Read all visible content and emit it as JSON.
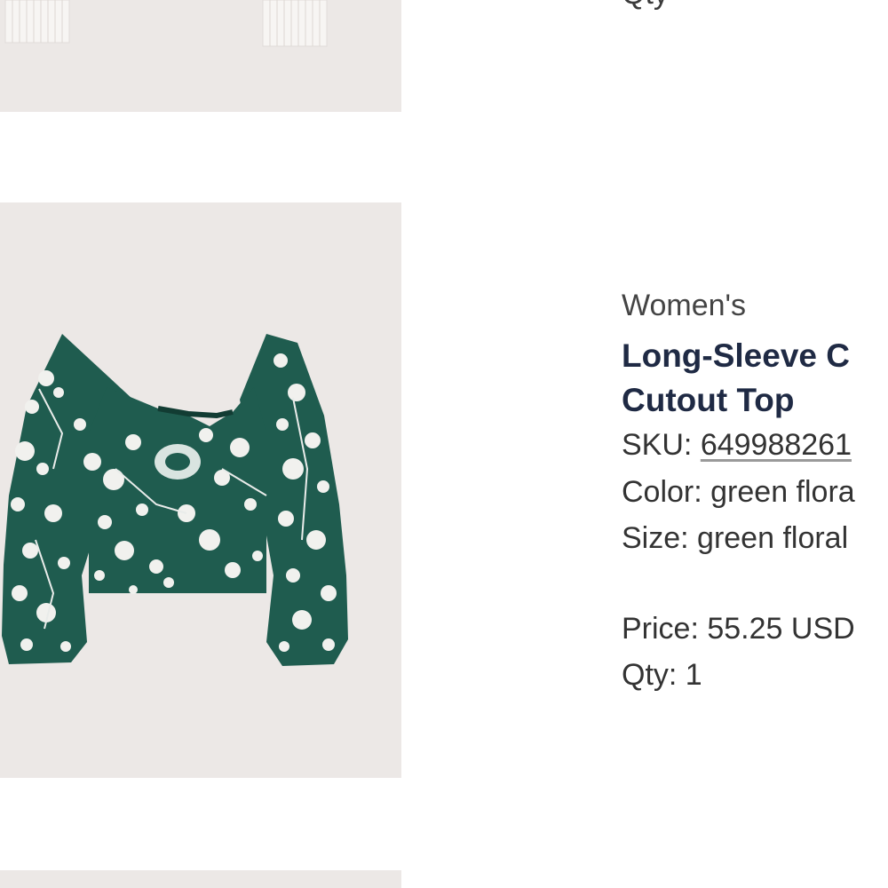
{
  "products": {
    "previous": {
      "qty_label": "Qty"
    },
    "current": {
      "category": "Women's",
      "title_line1": "Long-Sleeve C",
      "title_line2": "Cutout Top",
      "sku_label": "SKU: ",
      "sku_value": "649988261",
      "color_line": "Color: green flora",
      "size_line": "Size: green floral",
      "price_line": "Price: 55.25 USD",
      "qty_line": "Qty: 1"
    }
  },
  "colors": {
    "image_background": "#ece8e6",
    "top_green": "#1f5c4f",
    "title_text": "#1f2a44"
  }
}
